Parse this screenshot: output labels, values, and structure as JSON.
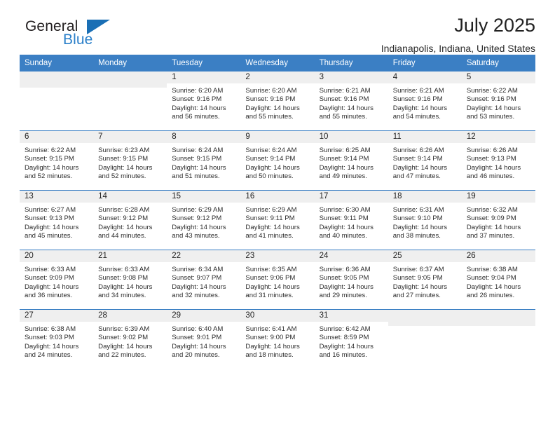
{
  "brand": {
    "name_top": "General",
    "name_bottom": "Blue",
    "accent_color": "#2a7fc9",
    "triangle_color": "#1a6fb5",
    "top_color": "#231f20"
  },
  "header": {
    "title": "July 2025",
    "subtitle": "Indianapolis, Indiana, United States"
  },
  "theme": {
    "header_bar_color": "#3b7fc4",
    "daynum_band_color": "#efefef",
    "row_divider_color": "#3b7fc4",
    "text_color": "#2c2c2c"
  },
  "columns": [
    "Sunday",
    "Monday",
    "Tuesday",
    "Wednesday",
    "Thursday",
    "Friday",
    "Saturday"
  ],
  "labels": {
    "sunrise": "Sunrise:",
    "sunset": "Sunset:",
    "daylight": "Daylight:"
  },
  "weeks": [
    [
      {
        "day": "",
        "sunrise": "",
        "sunset": "",
        "daylight": ""
      },
      {
        "day": "",
        "sunrise": "",
        "sunset": "",
        "daylight": ""
      },
      {
        "day": "1",
        "sunrise": "Sunrise: 6:20 AM",
        "sunset": "Sunset: 9:16 PM",
        "daylight": "Daylight: 14 hours and 56 minutes."
      },
      {
        "day": "2",
        "sunrise": "Sunrise: 6:20 AM",
        "sunset": "Sunset: 9:16 PM",
        "daylight": "Daylight: 14 hours and 55 minutes."
      },
      {
        "day": "3",
        "sunrise": "Sunrise: 6:21 AM",
        "sunset": "Sunset: 9:16 PM",
        "daylight": "Daylight: 14 hours and 55 minutes."
      },
      {
        "day": "4",
        "sunrise": "Sunrise: 6:21 AM",
        "sunset": "Sunset: 9:16 PM",
        "daylight": "Daylight: 14 hours and 54 minutes."
      },
      {
        "day": "5",
        "sunrise": "Sunrise: 6:22 AM",
        "sunset": "Sunset: 9:16 PM",
        "daylight": "Daylight: 14 hours and 53 minutes."
      }
    ],
    [
      {
        "day": "6",
        "sunrise": "Sunrise: 6:22 AM",
        "sunset": "Sunset: 9:15 PM",
        "daylight": "Daylight: 14 hours and 52 minutes."
      },
      {
        "day": "7",
        "sunrise": "Sunrise: 6:23 AM",
        "sunset": "Sunset: 9:15 PM",
        "daylight": "Daylight: 14 hours and 52 minutes."
      },
      {
        "day": "8",
        "sunrise": "Sunrise: 6:24 AM",
        "sunset": "Sunset: 9:15 PM",
        "daylight": "Daylight: 14 hours and 51 minutes."
      },
      {
        "day": "9",
        "sunrise": "Sunrise: 6:24 AM",
        "sunset": "Sunset: 9:14 PM",
        "daylight": "Daylight: 14 hours and 50 minutes."
      },
      {
        "day": "10",
        "sunrise": "Sunrise: 6:25 AM",
        "sunset": "Sunset: 9:14 PM",
        "daylight": "Daylight: 14 hours and 49 minutes."
      },
      {
        "day": "11",
        "sunrise": "Sunrise: 6:26 AM",
        "sunset": "Sunset: 9:14 PM",
        "daylight": "Daylight: 14 hours and 47 minutes."
      },
      {
        "day": "12",
        "sunrise": "Sunrise: 6:26 AM",
        "sunset": "Sunset: 9:13 PM",
        "daylight": "Daylight: 14 hours and 46 minutes."
      }
    ],
    [
      {
        "day": "13",
        "sunrise": "Sunrise: 6:27 AM",
        "sunset": "Sunset: 9:13 PM",
        "daylight": "Daylight: 14 hours and 45 minutes."
      },
      {
        "day": "14",
        "sunrise": "Sunrise: 6:28 AM",
        "sunset": "Sunset: 9:12 PM",
        "daylight": "Daylight: 14 hours and 44 minutes."
      },
      {
        "day": "15",
        "sunrise": "Sunrise: 6:29 AM",
        "sunset": "Sunset: 9:12 PM",
        "daylight": "Daylight: 14 hours and 43 minutes."
      },
      {
        "day": "16",
        "sunrise": "Sunrise: 6:29 AM",
        "sunset": "Sunset: 9:11 PM",
        "daylight": "Daylight: 14 hours and 41 minutes."
      },
      {
        "day": "17",
        "sunrise": "Sunrise: 6:30 AM",
        "sunset": "Sunset: 9:11 PM",
        "daylight": "Daylight: 14 hours and 40 minutes."
      },
      {
        "day": "18",
        "sunrise": "Sunrise: 6:31 AM",
        "sunset": "Sunset: 9:10 PM",
        "daylight": "Daylight: 14 hours and 38 minutes."
      },
      {
        "day": "19",
        "sunrise": "Sunrise: 6:32 AM",
        "sunset": "Sunset: 9:09 PM",
        "daylight": "Daylight: 14 hours and 37 minutes."
      }
    ],
    [
      {
        "day": "20",
        "sunrise": "Sunrise: 6:33 AM",
        "sunset": "Sunset: 9:09 PM",
        "daylight": "Daylight: 14 hours and 36 minutes."
      },
      {
        "day": "21",
        "sunrise": "Sunrise: 6:33 AM",
        "sunset": "Sunset: 9:08 PM",
        "daylight": "Daylight: 14 hours and 34 minutes."
      },
      {
        "day": "22",
        "sunrise": "Sunrise: 6:34 AM",
        "sunset": "Sunset: 9:07 PM",
        "daylight": "Daylight: 14 hours and 32 minutes."
      },
      {
        "day": "23",
        "sunrise": "Sunrise: 6:35 AM",
        "sunset": "Sunset: 9:06 PM",
        "daylight": "Daylight: 14 hours and 31 minutes."
      },
      {
        "day": "24",
        "sunrise": "Sunrise: 6:36 AM",
        "sunset": "Sunset: 9:05 PM",
        "daylight": "Daylight: 14 hours and 29 minutes."
      },
      {
        "day": "25",
        "sunrise": "Sunrise: 6:37 AM",
        "sunset": "Sunset: 9:05 PM",
        "daylight": "Daylight: 14 hours and 27 minutes."
      },
      {
        "day": "26",
        "sunrise": "Sunrise: 6:38 AM",
        "sunset": "Sunset: 9:04 PM",
        "daylight": "Daylight: 14 hours and 26 minutes."
      }
    ],
    [
      {
        "day": "27",
        "sunrise": "Sunrise: 6:38 AM",
        "sunset": "Sunset: 9:03 PM",
        "daylight": "Daylight: 14 hours and 24 minutes."
      },
      {
        "day": "28",
        "sunrise": "Sunrise: 6:39 AM",
        "sunset": "Sunset: 9:02 PM",
        "daylight": "Daylight: 14 hours and 22 minutes."
      },
      {
        "day": "29",
        "sunrise": "Sunrise: 6:40 AM",
        "sunset": "Sunset: 9:01 PM",
        "daylight": "Daylight: 14 hours and 20 minutes."
      },
      {
        "day": "30",
        "sunrise": "Sunrise: 6:41 AM",
        "sunset": "Sunset: 9:00 PM",
        "daylight": "Daylight: 14 hours and 18 minutes."
      },
      {
        "day": "31",
        "sunrise": "Sunrise: 6:42 AM",
        "sunset": "Sunset: 8:59 PM",
        "daylight": "Daylight: 14 hours and 16 minutes."
      },
      {
        "day": "",
        "sunrise": "",
        "sunset": "",
        "daylight": ""
      },
      {
        "day": "",
        "sunrise": "",
        "sunset": "",
        "daylight": ""
      }
    ]
  ]
}
